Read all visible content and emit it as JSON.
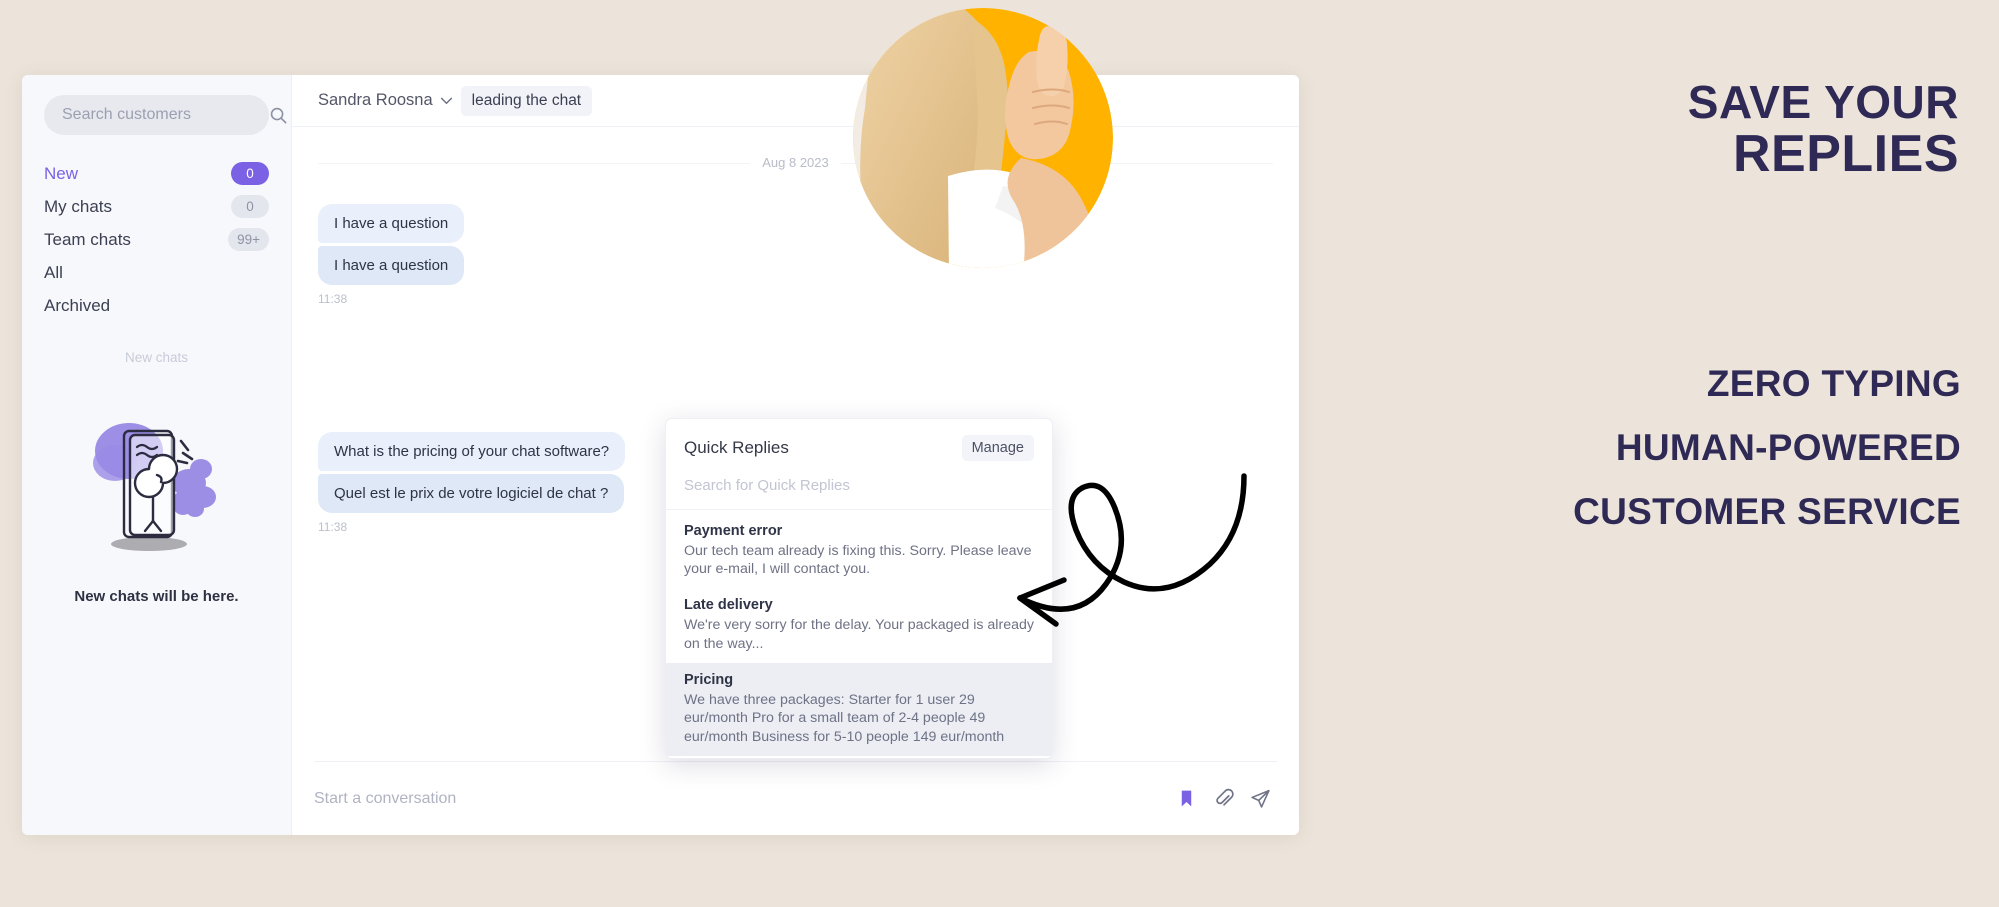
{
  "app": {
    "sidebar": {
      "search": {
        "placeholder": "Search customers",
        "value": "",
        "icon": "search-icon"
      },
      "items": [
        {
          "label": "New",
          "badge": "0",
          "active": true
        },
        {
          "label": "My chats",
          "badge": "0",
          "active": false
        },
        {
          "label": "Team chats",
          "badge": "99+",
          "active": false
        },
        {
          "label": "All",
          "badge": "",
          "active": false
        },
        {
          "label": "Archived",
          "badge": "",
          "active": false
        }
      ],
      "divider_label": "New chats",
      "empty_state_text": "New chats will be here."
    },
    "chat_header": {
      "agent_name": "Sandra Roosna",
      "chevron_icon": "chevron-down-icon",
      "role_chip": "leading the chat"
    },
    "conversation": {
      "date_separator": "Aug 8 2023",
      "groups": [
        {
          "messages": [
            "I have a question",
            "I have a question"
          ],
          "time": "11:38"
        },
        {
          "messages": [
            "What is the pricing of your chat software?",
            "Quel est le prix de votre logiciel de chat ?"
          ],
          "time": "11:38"
        }
      ]
    },
    "quick_replies": {
      "title": "Quick Replies",
      "manage_label": "Manage",
      "search_placeholder": "Search for Quick Replies",
      "search_value": "",
      "items": [
        {
          "title": "Payment error",
          "body": "Our tech team already is fixing this. Sorry. Please leave your e-mail, I will contact you.",
          "selected": false
        },
        {
          "title": "Late delivery",
          "body": "We're very sorry for the delay. Your packaged is already on the way...",
          "selected": false
        },
        {
          "title": "Pricing",
          "body": "We have three packages: Starter for 1 user 29 eur/month Pro for a small team of 2-4 people 49 eur/month Business for 5-10 people 149 eur/month",
          "selected": true
        }
      ]
    },
    "composer": {
      "placeholder": "Start a conversation",
      "value": "",
      "actions": [
        {
          "icon": "bookmark-icon",
          "color": "#7b61e4"
        },
        {
          "icon": "paperclip-icon",
          "color": "#6f7386"
        },
        {
          "icon": "send-icon",
          "color": "#6f7386"
        }
      ]
    }
  },
  "promo": {
    "headline_line1": "SAVE YOUR",
    "headline_line2": "REPLIES",
    "subline1": "ZERO TYPING",
    "subline2": "HUMAN-POWERED",
    "subline3": "CUSTOMER SERVICE"
  },
  "colors": {
    "background": "#ece4da",
    "accent_purple": "#7b61e4",
    "promo_text": "#2f2a55",
    "photo_yellow": "#ffb200"
  }
}
